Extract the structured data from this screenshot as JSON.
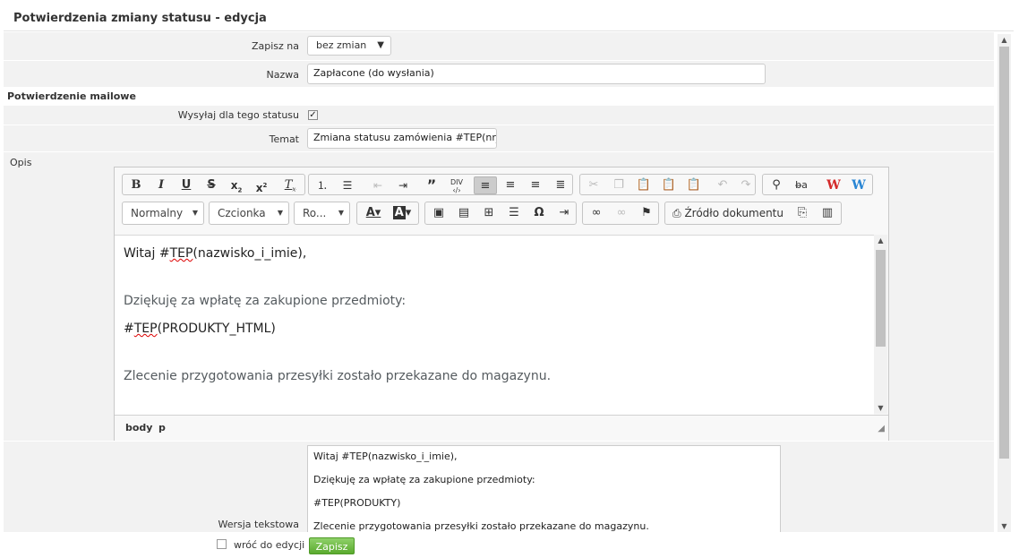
{
  "page": {
    "title": "Potwierdzenia zmiany statusu - edycja"
  },
  "form": {
    "save_to": {
      "label": "Zapisz na",
      "value": "bez zmian"
    },
    "name": {
      "label": "Nazwa",
      "value": "Zapłacone (do wysłania)"
    },
    "email_section": "Potwierdzenie mailowe",
    "send_for_status": {
      "label": "Wysyłaj dla tego statusu",
      "checked": true
    },
    "subject": {
      "label": "Temat",
      "value": "Zmiana statusu zamówienia #TEP(nr_zam"
    },
    "description_label": "Opis",
    "text_version_label": "Wersja tekstowa"
  },
  "editor": {
    "format_combo": "Normalny",
    "font_combo": "Czcionka",
    "size_combo": "Ro...",
    "source_label": "Źródło dokumentu",
    "path": [
      "body",
      "p"
    ],
    "content": {
      "line1_prefix": "Witaj #",
      "line1_tep": "TEP",
      "line1_suffix": "(nazwisko_i_imie),",
      "line2": "Dziękuję za wpłatę za zakupione przedmioty:",
      "line3_prefix": "#",
      "line3_tep": "TEP",
      "line3_suffix": "(PRODUKTY_HTML)",
      "line4": "Zlecenie przygotowania przesyłki zostało przekazane do magazynu."
    }
  },
  "text_version": {
    "lines": [
      "Witaj #TEP(nazwisko_i_imie),",
      "Dziękuję za wpłatę za zakupione przedmioty:",
      "#TEP(PRODUKTY)",
      "Zlecenie przygotowania przesyłki zostało przekazane do magazynu."
    ]
  },
  "footer": {
    "back_to_edit": "wróć do edycji",
    "save_button": "Zapisz"
  },
  "colors": {
    "save_green": "#6cbf3f",
    "row_bg": "#f2f2f2",
    "content_gray_text": "#555b5f"
  }
}
